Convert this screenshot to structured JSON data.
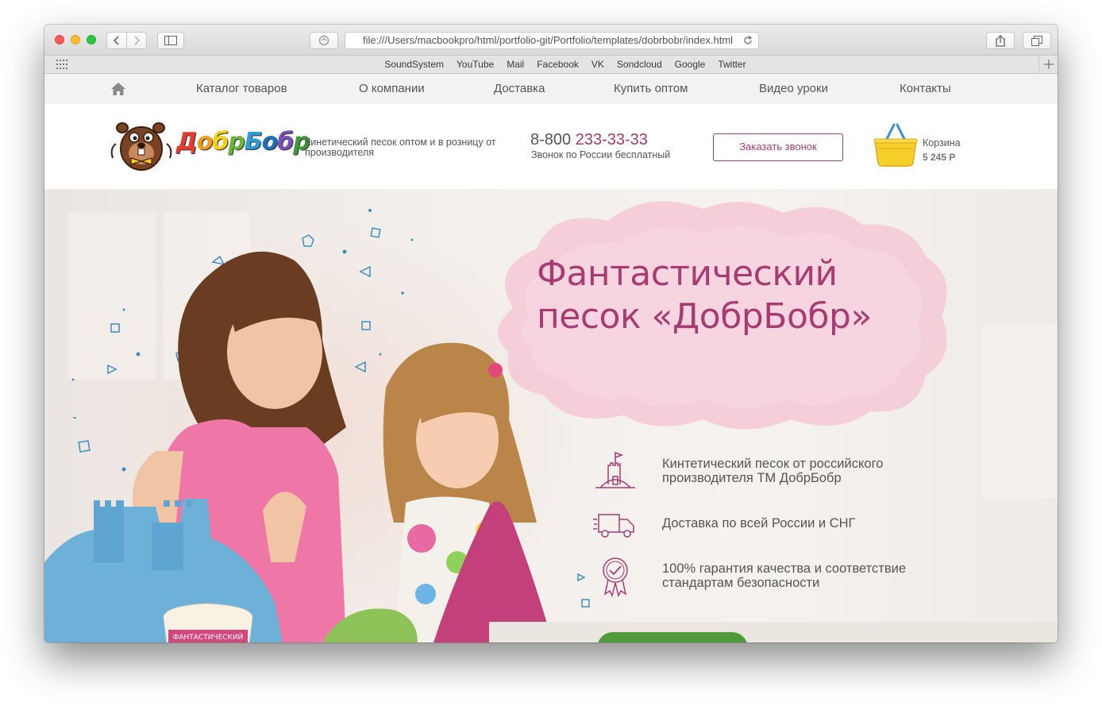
{
  "browser": {
    "url": "file:///Users/macbookpro/html/portfolio-git/Portfolio/templates/dobrbobr/index.html",
    "bookmarks": [
      "SoundSystem",
      "YouTube",
      "Mail",
      "Facebook",
      "VK",
      "Sondcloud",
      "Google",
      "Twitter"
    ]
  },
  "nav": {
    "items": [
      "Каталог товаров",
      "О компании",
      "Доставка",
      "Купить оптом",
      "Видео уроки",
      "Контакты"
    ]
  },
  "header": {
    "logo_text": "ДобрБобр",
    "tagline": "Кинетический песок оптом и в розницу от производителя",
    "phone_prefix": "8-800 ",
    "phone_number": "233-33-33",
    "phone_note": "Звонок по России бесплатный",
    "call_button": "Заказать звонок",
    "cart_label": "Корзина",
    "cart_sum": "5 245 Р"
  },
  "hero": {
    "title_line1": "Фантастический",
    "title_line2": "песок «ДобрБобр»",
    "features": [
      {
        "icon": "sand-castle-icon",
        "text": "Кинтетический песок от российского производителя ТМ ДобрБобр"
      },
      {
        "icon": "delivery-truck-icon",
        "text": "Доставка по всей России и СНГ"
      },
      {
        "icon": "quality-badge-icon",
        "text": "100% гарантия качества и соответствие стандартам безопасности"
      }
    ],
    "jar_label": "ФАНТАСТИЧЕСКИЙ"
  },
  "colors": {
    "accent": "#a83c72",
    "cta_green": "#4f9b3c",
    "nav_bg": "#f2f2f2"
  }
}
